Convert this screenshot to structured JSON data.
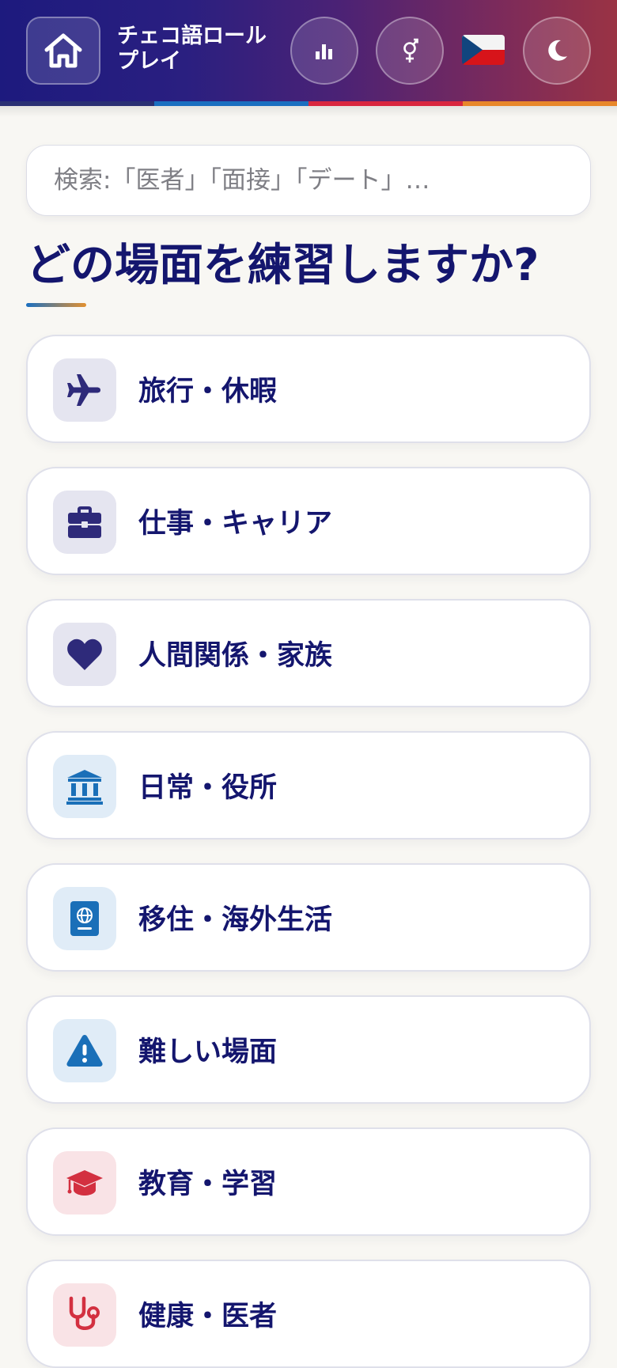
{
  "header": {
    "title": "チェコ語ロールプレイ",
    "title_line1": "チェコ語ロール",
    "title_line2": "プレイ",
    "flag": "🇨🇿",
    "colors": {
      "gradient_start": "#1d1a7e",
      "gradient_end": "#9a3344",
      "stripe": [
        "#2a2f73",
        "#1a6fc0",
        "#d9263f",
        "#e8872a"
      ]
    },
    "icons": [
      "home-icon",
      "stats-bar-chart-icon",
      "gender-icon",
      "czech-flag-icon",
      "moon-icon"
    ]
  },
  "search": {
    "placeholder": "検索:「医者」「面接」「デート」…",
    "value": ""
  },
  "main": {
    "heading": "どの場面を練習しますか?",
    "categories": [
      {
        "label": "旅行・休暇",
        "icon": "airplane-icon",
        "icon_color": "#2e2a7a",
        "icon_bg": "#e5e5f0"
      },
      {
        "label": "仕事・キャリア",
        "icon": "briefcase-icon",
        "icon_color": "#2e2a7a",
        "icon_bg": "#e5e5f0"
      },
      {
        "label": "人間関係・家族",
        "icon": "heart-icon",
        "icon_color": "#2e2a7a",
        "icon_bg": "#e5e5f0"
      },
      {
        "label": "日常・役所",
        "icon": "government-building-icon",
        "icon_color": "#1a6fb8",
        "icon_bg": "#e0ecf7"
      },
      {
        "label": "移住・海外生活",
        "icon": "passport-icon",
        "icon_color": "#1a6fb8",
        "icon_bg": "#e0ecf7"
      },
      {
        "label": "難しい場面",
        "icon": "warning-icon",
        "icon_color": "#1a6fb8",
        "icon_bg": "#e0ecf7"
      },
      {
        "label": "教育・学習",
        "icon": "graduation-cap-icon",
        "icon_color": "#d33040",
        "icon_bg": "#f9e3e6"
      },
      {
        "label": "健康・医者",
        "icon": "stethoscope-icon",
        "icon_color": "#d33040",
        "icon_bg": "#f9e3e6"
      }
    ]
  }
}
